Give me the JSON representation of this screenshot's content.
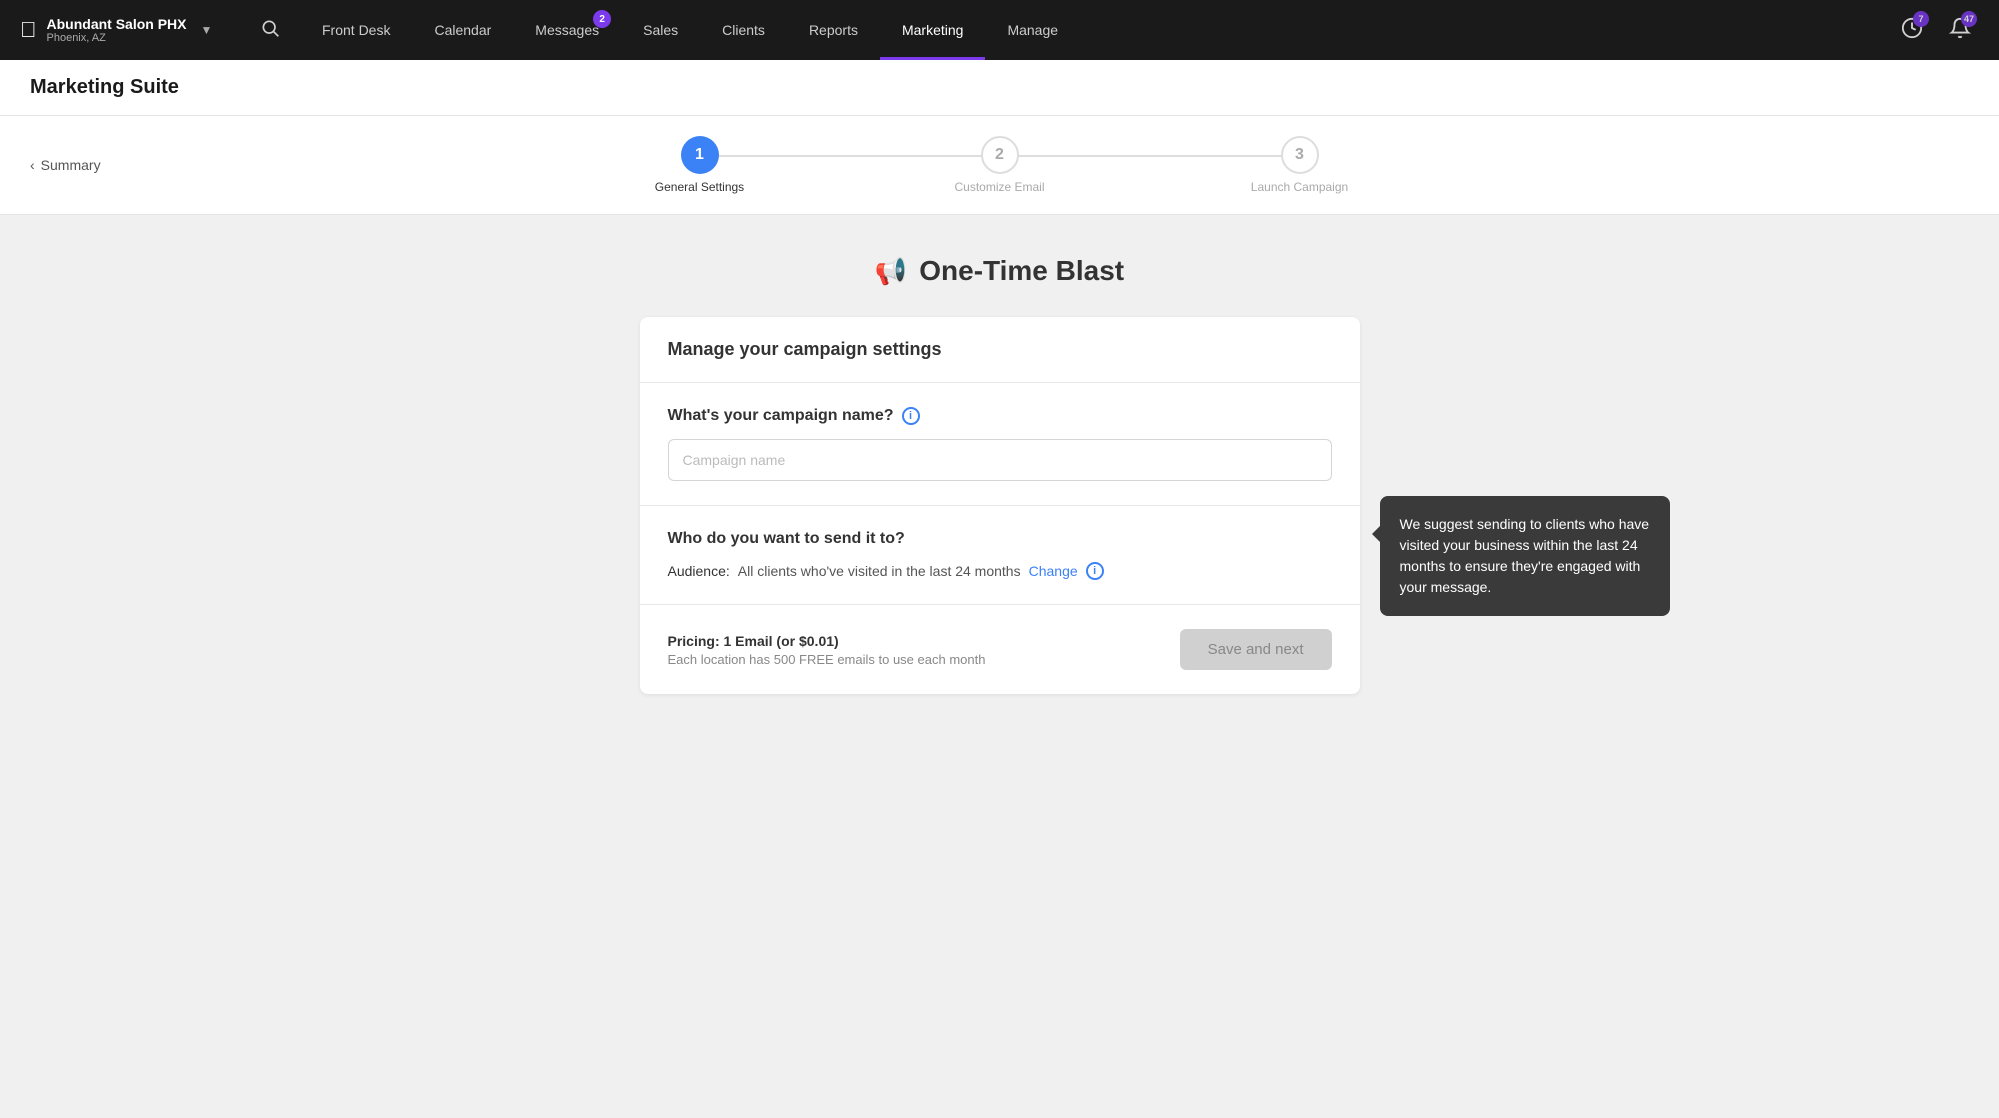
{
  "nav": {
    "brand": {
      "name": "Abundant Salon PHX",
      "location": "Phoenix, AZ"
    },
    "items": [
      {
        "label": "Front Desk",
        "active": false,
        "badge": null
      },
      {
        "label": "Calendar",
        "active": false,
        "badge": null
      },
      {
        "label": "Messages",
        "active": false,
        "badge": "2"
      },
      {
        "label": "Sales",
        "active": false,
        "badge": null
      },
      {
        "label": "Clients",
        "active": false,
        "badge": null
      },
      {
        "label": "Reports",
        "active": false,
        "badge": null
      },
      {
        "label": "Marketing",
        "active": true,
        "badge": null
      },
      {
        "label": "Manage",
        "active": false,
        "badge": null
      }
    ],
    "clock_badge": "7",
    "bell_badge": "47"
  },
  "page": {
    "title": "Marketing Suite"
  },
  "stepper": {
    "back_label": "Summary",
    "steps": [
      {
        "number": "1",
        "label": "General Settings",
        "state": "active"
      },
      {
        "number": "2",
        "label": "Customize Email",
        "state": "inactive"
      },
      {
        "number": "3",
        "label": "Launch Campaign",
        "state": "inactive"
      }
    ]
  },
  "campaign": {
    "page_title": "One-Time Blast",
    "card_heading": "Manage your campaign settings",
    "name_question": "What's your campaign name?",
    "name_placeholder": "Campaign name",
    "audience_question": "Who do you want to send it to?",
    "audience_label": "Audience:",
    "audience_value": "All clients who've visited in the last 24 months",
    "change_link": "Change",
    "pricing_heading": "Pricing: 1 Email (or $0.01)",
    "pricing_sub": "Each location has 500 FREE emails to use each month",
    "save_next_label": "Save and next",
    "tooltip_text": "We suggest sending to clients who have visited your business within the last 24 months to ensure they're engaged with your message."
  }
}
